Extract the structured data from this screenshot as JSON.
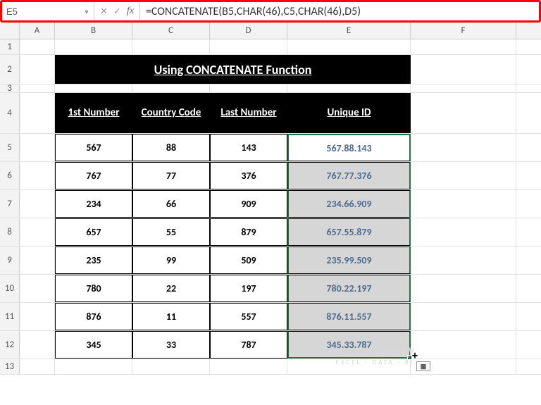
{
  "nameBox": "E5",
  "formula": "=CONCATENATE(B5,CHAR(46),C5,CHAR(46),D5)",
  "columns": [
    "A",
    "B",
    "C",
    "D",
    "E",
    "F"
  ],
  "rowLabels": [
    "1",
    "2",
    "3",
    "4",
    "5",
    "6",
    "7",
    "8",
    "9",
    "10",
    "11",
    "12",
    "13"
  ],
  "title": "Using CONCATENATE Function",
  "headers": {
    "b": "1st Number",
    "c": "Country Code",
    "d": "Last Number",
    "e": "Unique ID"
  },
  "data": [
    {
      "b": "567",
      "c": "88",
      "d": "143",
      "e": "567.88.143"
    },
    {
      "b": "767",
      "c": "77",
      "d": "376",
      "e": "767.77.376"
    },
    {
      "b": "234",
      "c": "66",
      "d": "909",
      "e": "234.66.909"
    },
    {
      "b": "657",
      "c": "55",
      "d": "879",
      "e": "657.55.879"
    },
    {
      "b": "235",
      "c": "99",
      "d": "509",
      "e": "235.99.509"
    },
    {
      "b": "780",
      "c": "22",
      "d": "197",
      "e": "780.22.197"
    },
    {
      "b": "876",
      "c": "11",
      "d": "557",
      "e": "876.11.557"
    },
    {
      "b": "345",
      "c": "33",
      "d": "787",
      "e": "345.33.787"
    }
  ],
  "watermark": {
    "line1": "exceldemy",
    "line2": "EXCEL · DATA · BI"
  },
  "icons": {
    "cancel": "✕",
    "confirm": "✓",
    "dropdown": "▾"
  }
}
